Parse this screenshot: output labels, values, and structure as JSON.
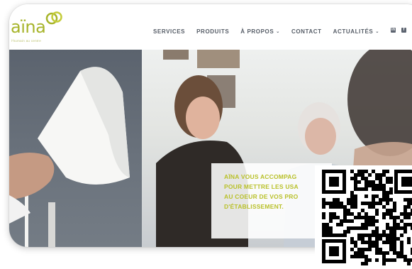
{
  "logo": {
    "name": "aïna",
    "tagline": "l'humain au centre"
  },
  "nav": {
    "items": [
      {
        "label": "SERVICES",
        "has_dropdown": false
      },
      {
        "label": "PRODUITS",
        "has_dropdown": false
      },
      {
        "label": "À PROPOS",
        "has_dropdown": true
      },
      {
        "label": "CONTACT",
        "has_dropdown": false
      },
      {
        "label": "ACTUALITÉS",
        "has_dropdown": true
      }
    ],
    "chevron": "⌄"
  },
  "social": {
    "icons": [
      "linkedin-icon",
      "facebook-icon"
    ],
    "glyphs": [
      "in",
      "f"
    ]
  },
  "hero": {
    "overlay_lines": [
      "AÏNA VOUS ACCOMPAG",
      "POUR METTRE LES USA",
      "AU COEUR DE VOS PRO",
      "D'ÉTABLISSEMENT."
    ]
  },
  "colors": {
    "brand_green": "#a7b42a",
    "nav_text": "#555c66",
    "overlay_text": "#b9c12a"
  }
}
